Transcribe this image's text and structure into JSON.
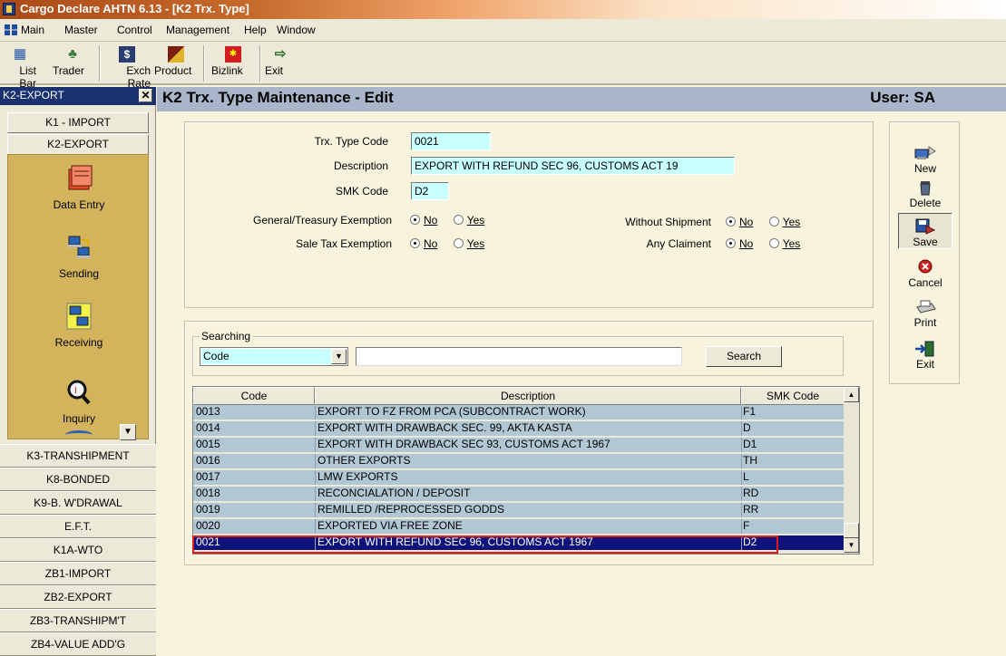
{
  "window": {
    "title": "Cargo Declare AHTN 6.13 - [K2 Trx. Type]"
  },
  "menu": [
    "Main",
    "Master",
    "Control",
    "Management",
    "Help",
    "Window"
  ],
  "toolbar": {
    "list_bar": "List Bar",
    "trader": "Trader",
    "exch_rate": "Exch Rate",
    "product": "Product",
    "bizlink": "Bizlink",
    "exit": "Exit"
  },
  "sidebar": {
    "title": "K2-EXPORT",
    "top_buttons": [
      "K1 - IMPORT",
      "K2-EXPORT"
    ],
    "icons": [
      "Data Entry",
      "Sending",
      "Receiving",
      "Inquiry"
    ],
    "bottom_buttons": [
      "K3-TRANSHIPMENT",
      "K8-BONDED",
      "K9-B. W'DRAWAL",
      "E.F.T.",
      "K1A-WTO",
      "ZB1-IMPORT",
      "ZB2-EXPORT",
      "ZB3-TRANSHIPM'T",
      "ZB4-VALUE ADD'G"
    ]
  },
  "header": {
    "title": "K2 Trx. Type Maintenance -   Edit",
    "user": "User: SA"
  },
  "form": {
    "trx_type_code_label": "Trx. Type Code",
    "trx_type_code": "0021",
    "description_label": "Description",
    "description": "EXPORT WITH REFUND SEC 96, CUSTOMS ACT 19",
    "smk_code_label": "SMK Code",
    "smk_code": "D2",
    "general_treasury_label": "General/Treasury Exemption",
    "sale_tax_label": "Sale Tax Exemption",
    "without_shipment_label": "Without Shipment",
    "any_claiment_label": "Any Claiment",
    "no_label": "No",
    "yes_label": "Yes"
  },
  "search": {
    "legend": "Searching",
    "field_selected": "Code",
    "text": "",
    "button": "Search"
  },
  "grid": {
    "columns": [
      "Code",
      "Description",
      "SMK Code"
    ],
    "rows": [
      {
        "code": "0013",
        "description": "EXPORT TO FZ FROM PCA (SUBCONTRACT WORK)",
        "smk": "F1"
      },
      {
        "code": "0014",
        "description": "EXPORT WITH DRAWBACK SEC. 99, AKTA KASTA",
        "smk": "D"
      },
      {
        "code": "0015",
        "description": "EXPORT WITH DRAWBACK SEC 93, CUSTOMS ACT 1967",
        "smk": "D1"
      },
      {
        "code": "0016",
        "description": "OTHER EXPORTS",
        "smk": "TH"
      },
      {
        "code": "0017",
        "description": "LMW EXPORTS",
        "smk": "L"
      },
      {
        "code": "0018",
        "description": "RECONCIALATION / DEPOSIT",
        "smk": "RD"
      },
      {
        "code": "0019",
        "description": "REMILLED /REPROCESSED GODDS",
        "smk": "RR"
      },
      {
        "code": "0020",
        "description": "EXPORTED VIA FREE ZONE",
        "smk": "F"
      },
      {
        "code": "0021",
        "description": "EXPORT WITH REFUND SEC 96, CUSTOMS ACT 1967",
        "smk": "D2"
      }
    ]
  },
  "actions": {
    "new": "New",
    "delete": "Delete",
    "save": "Save",
    "cancel": "Cancel",
    "print": "Print",
    "exit": "Exit"
  },
  "colors": {
    "accent": "#0d137b",
    "field_bg": "#c8ffff",
    "grid_row_bg": "#b1c8d4",
    "panel_gold": "#d4b35d",
    "header_bg": "#a9b6c9"
  }
}
